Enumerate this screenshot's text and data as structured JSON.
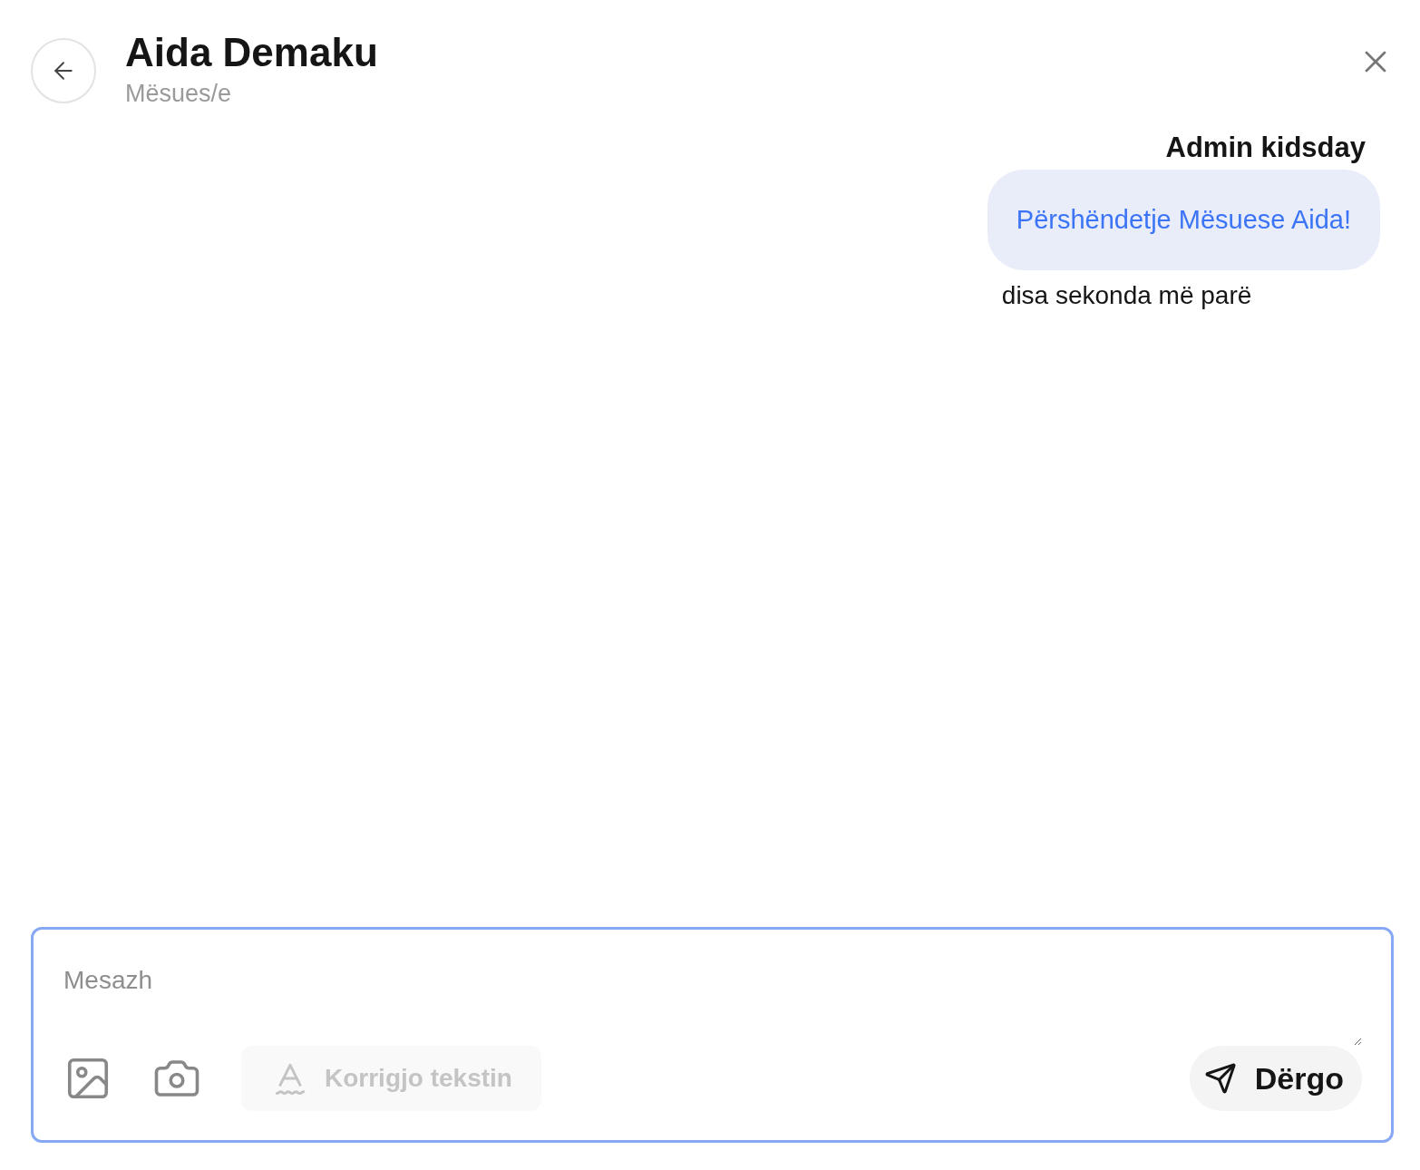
{
  "header": {
    "title": "Aida Demaku",
    "subtitle": "Mësues/e"
  },
  "messages": [
    {
      "sender": "Admin kidsday",
      "text": "Përshëndetje Mësuese Aida!",
      "time": "disa sekonda më parë",
      "outgoing": true
    }
  ],
  "composer": {
    "placeholder": "Mesazh",
    "correct_button": {
      "label": "Korrigjo tekstin",
      "disabled": true
    },
    "send_button": {
      "label": "Dërgo"
    }
  }
}
